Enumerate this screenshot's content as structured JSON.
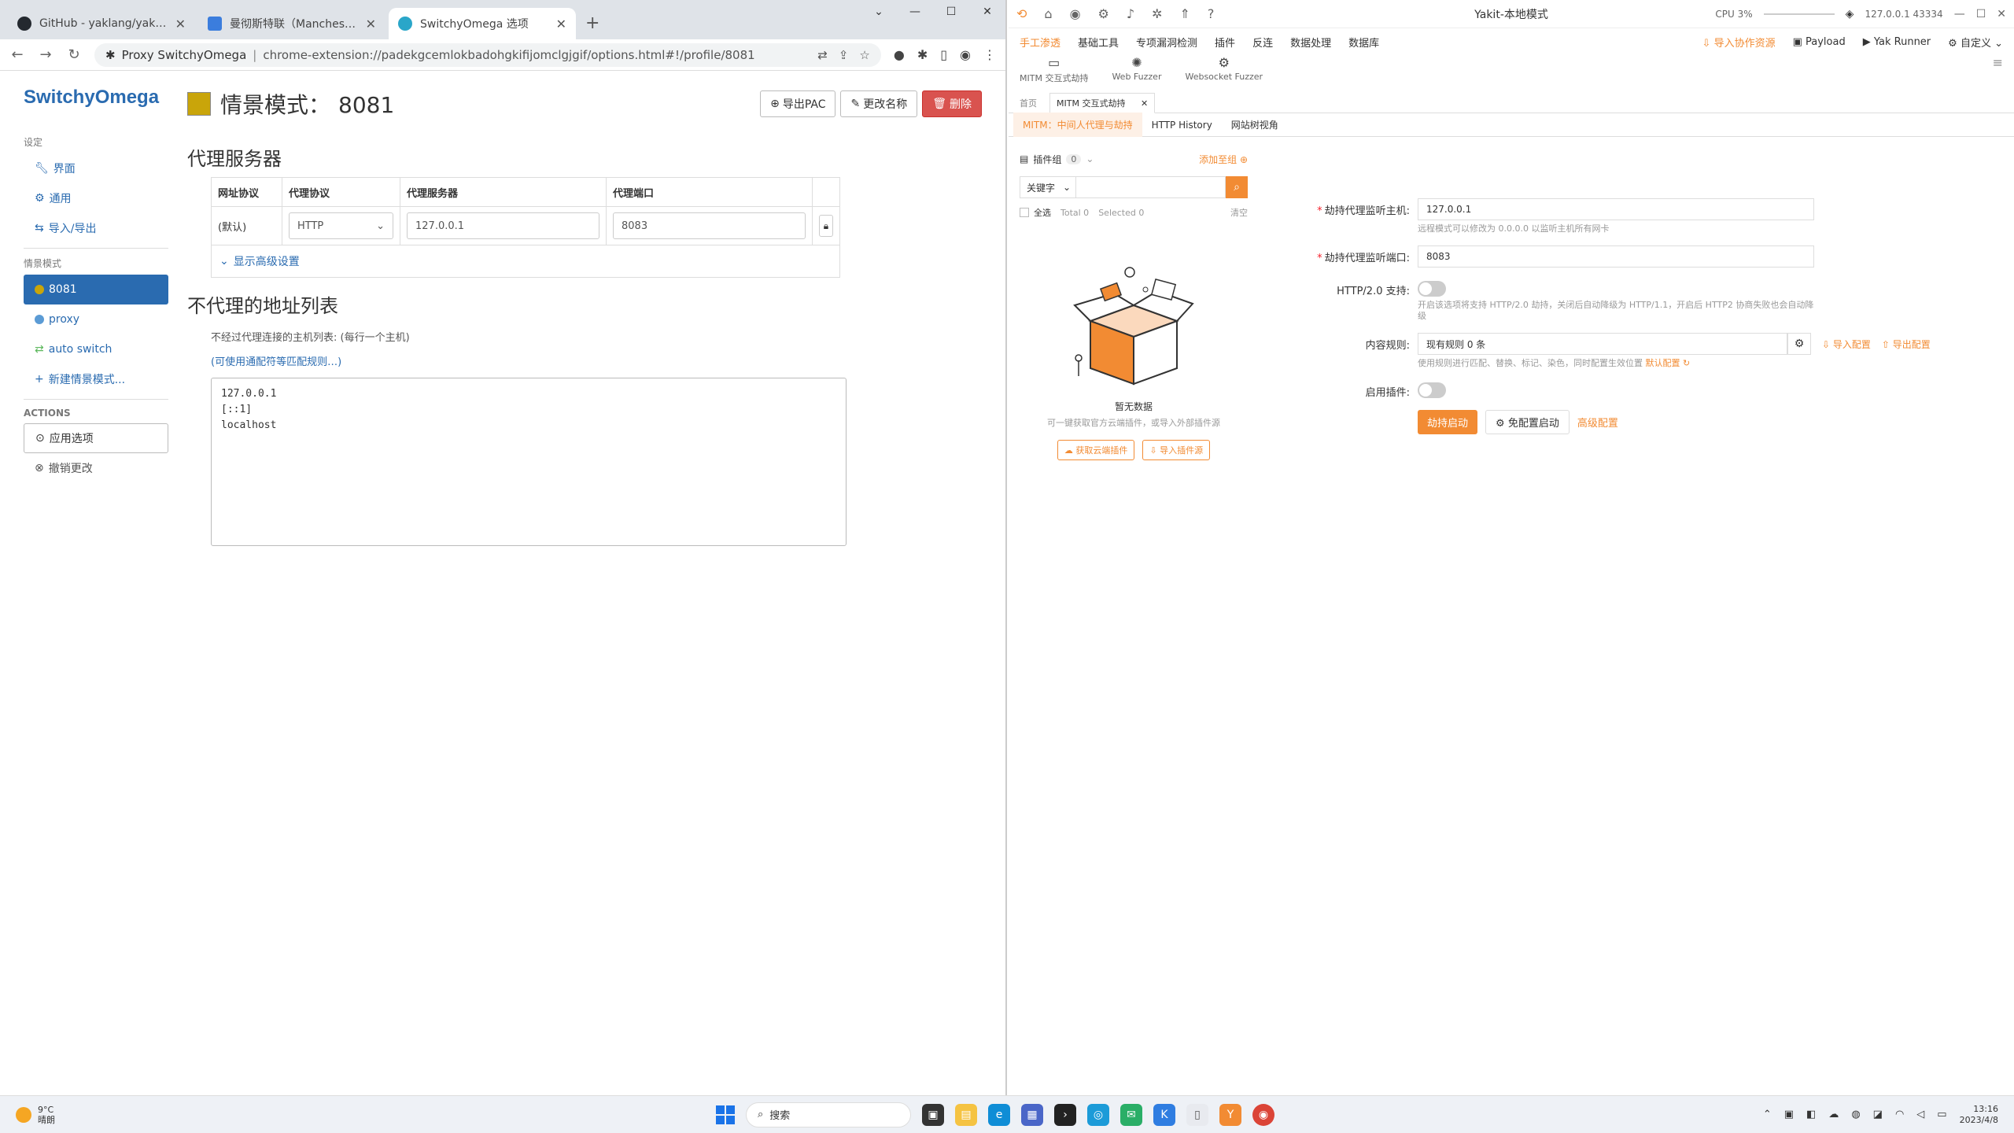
{
  "chrome": {
    "tabs": [
      {
        "title": "GitHub - yaklang/yakit: Cyber",
        "color": "#24292f",
        "active": false
      },
      {
        "title": "曼彻斯特联（Manchester Unit",
        "color": "#3b7ddd",
        "active": false
      },
      {
        "title": "SwitchyOmega 选项",
        "color": "#2aa6c9",
        "active": true
      }
    ],
    "new_tab": "+",
    "url_site": "Proxy SwitchyOmega",
    "url_sep": "|",
    "url_path": "chrome-extension://padekgcemlokbadohgkifijomclgjgif/options.html#!/profile/8081"
  },
  "so": {
    "brand": "SwitchyOmega",
    "section_settings": "设定",
    "nav_settings": [
      {
        "label": "界面",
        "icon": "wrench-icon"
      },
      {
        "label": "通用",
        "icon": "gear-icon"
      },
      {
        "label": "导入/导出",
        "icon": "transfer-icon"
      }
    ],
    "section_profiles": "情景模式",
    "nav_profiles": [
      {
        "label": "8081",
        "color": "#c9a50a",
        "active": true
      },
      {
        "label": "proxy",
        "color": "#5b9bd5",
        "active": false
      },
      {
        "label": "auto switch",
        "color": "#5cb85c",
        "active": false
      }
    ],
    "new_profile": "新建情景模式...",
    "section_actions": "ACTIONS",
    "apply": "应用选项",
    "discard": "撤销更改",
    "title_prefix": "情景模式：",
    "title_value": "8081",
    "btn_export_pac": "导出PAC",
    "btn_rename": "更改名称",
    "btn_delete": "删除",
    "h_proxy_servers": "代理服务器",
    "table_headers": [
      "网址协议",
      "代理协议",
      "代理服务器",
      "代理端口"
    ],
    "row_scheme": "(默认)",
    "row_protocol": "HTTP",
    "row_server": "127.0.0.1",
    "row_port": "8083",
    "show_advanced": "显示高级设置",
    "h_bypass": "不代理的地址列表",
    "bypass_desc": "不经过代理连接的主机列表: (每行一个主机)",
    "bypass_link": "(可使用通配符等匹配规则…)",
    "bypass_list": "127.0.0.1\n[::1]\nlocalhost"
  },
  "yk": {
    "title": "Yakit-本地模式",
    "cpu": "CPU 3%",
    "engine": "127.0.0.1 43334",
    "menu": [
      "手工渗透",
      "基础工具",
      "专项漏洞检测",
      "插件",
      "反连",
      "数据处理",
      "数据库"
    ],
    "menu_right": {
      "import": "导入协作资源",
      "payload": "Payload",
      "runner": "Yak Runner",
      "custom": "自定义"
    },
    "sub": [
      "MITM 交互式劫持",
      "Web Fuzzer",
      "Websocket Fuzzer"
    ],
    "page_tabs": [
      "首页",
      "MITM 交互式劫持"
    ],
    "mitm_tabs": [
      "MITM：中间人代理与劫持",
      "HTTP History",
      "网站树视角"
    ],
    "plugin_group": "插件组",
    "plugin_count": "0",
    "add_to_group": "添加至组",
    "keyword": "关键字",
    "select_all": "全选",
    "total": "Total 0",
    "selected": "Selected 0",
    "clear": "清空",
    "empty_title": "暂无数据",
    "empty_desc": "可一键获取官方云端插件，或导入外部插件源",
    "btn_cloud": "获取云端插件",
    "btn_import_src": "导入插件源",
    "f_host_label": "劫持代理监听主机:",
    "f_host": "127.0.0.1",
    "f_host_hint": "远程模式可以修改为 0.0.0.0 以监听主机所有网卡",
    "f_port_label": "劫持代理监听端口:",
    "f_port": "8083",
    "f_http2_label": "HTTP/2.0 支持:",
    "f_http2_hint": "开启该选项将支持 HTTP/2.0 劫持，关闭后自动降级为 HTTP/1.1，开启后 HTTP2 协商失败也会自动降级",
    "f_rules_label": "内容规则:",
    "f_rules": "现有规则 0 条",
    "f_rules_import": "导入配置",
    "f_rules_export": "导出配置",
    "f_rules_hint": "使用规则进行匹配、替换、标记、染色，同时配置生效位置",
    "f_rules_default": "默认配置",
    "f_plugin_label": "启用插件:",
    "btn_start": "劫持启动",
    "btn_noconf": "免配置启动",
    "btn_adv": "高级配置"
  },
  "taskbar": {
    "temp": "9°C",
    "weather": "晴朗",
    "search": "搜索",
    "time": "13:16",
    "date": "2023/4/8"
  }
}
